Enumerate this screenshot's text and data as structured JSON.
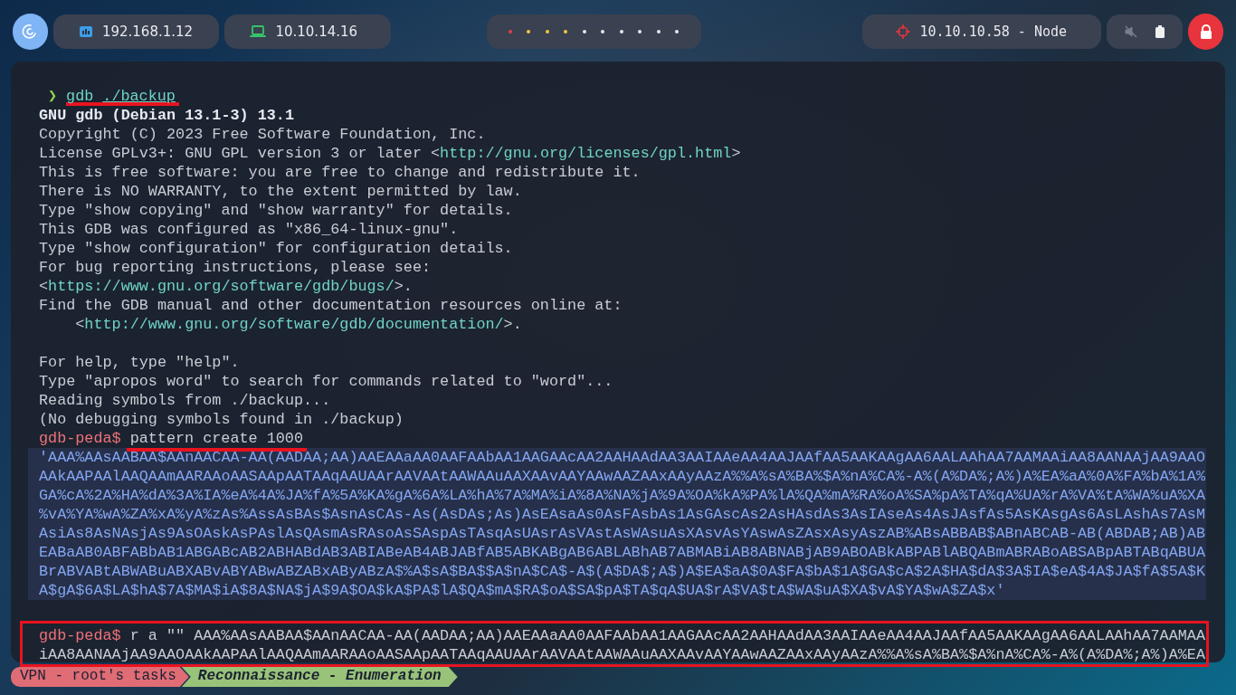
{
  "top_bar": {
    "ip_chips": [
      {
        "kind": "network",
        "text": "192.168.1.12"
      },
      {
        "kind": "laptop",
        "text": "10.10.14.16"
      }
    ],
    "workspaces": [
      {
        "color": "#e0404a"
      },
      {
        "color": "#f5c542"
      },
      {
        "color": "#f5c542"
      },
      {
        "color": "#f5c542"
      },
      {
        "color": "#e8e8e8"
      },
      {
        "color": "#e8e8e8"
      },
      {
        "color": "#e8e8e8"
      },
      {
        "color": "#e8e8e8"
      },
      {
        "color": "#e8e8e8"
      },
      {
        "color": "#e8e8e8"
      }
    ],
    "target": {
      "text": "10.10.10.58 - Node"
    }
  },
  "terminal": {
    "first_command": {
      "prompt": "❯",
      "program": "gdb",
      "argument": "./backup"
    },
    "output": [
      {
        "kind": "bold",
        "segments": [
          {
            "kind": "plain",
            "text": "GNU gdb (Debian 13.1-3) 13.1"
          }
        ]
      },
      {
        "kind": "plain",
        "segments": [
          {
            "kind": "plain",
            "text": "Copyright (C) 2023 Free Software Foundation, Inc."
          }
        ]
      },
      {
        "kind": "plain",
        "segments": [
          {
            "kind": "plain",
            "text": "License GPLv3+: GNU GPL version 3 or later <"
          },
          {
            "kind": "link",
            "text": "http://gnu.org/licenses/gpl.html"
          },
          {
            "kind": "plain",
            "text": ">"
          }
        ]
      },
      {
        "kind": "plain",
        "segments": [
          {
            "kind": "plain",
            "text": "This is free software: you are free to change and redistribute it."
          }
        ]
      },
      {
        "kind": "plain",
        "segments": [
          {
            "kind": "plain",
            "text": "There is NO WARRANTY, to the extent permitted by law."
          }
        ]
      },
      {
        "kind": "plain",
        "segments": [
          {
            "kind": "plain",
            "text": "Type \"show copying\" and \"show warranty\" for details."
          }
        ]
      },
      {
        "kind": "plain",
        "segments": [
          {
            "kind": "plain",
            "text": "This GDB was configured as \"x86_64-linux-gnu\"."
          }
        ]
      },
      {
        "kind": "plain",
        "segments": [
          {
            "kind": "plain",
            "text": "Type \"show configuration\" for configuration details."
          }
        ]
      },
      {
        "kind": "plain",
        "segments": [
          {
            "kind": "plain",
            "text": "For bug reporting instructions, please see:"
          }
        ]
      },
      {
        "kind": "plain",
        "segments": [
          {
            "kind": "plain",
            "text": "<"
          },
          {
            "kind": "link",
            "text": "https://www.gnu.org/software/gdb/bugs/"
          },
          {
            "kind": "plain",
            "text": ">."
          }
        ]
      },
      {
        "kind": "plain",
        "segments": [
          {
            "kind": "plain",
            "text": "Find the GDB manual and other documentation resources online at:"
          }
        ]
      },
      {
        "kind": "plain",
        "segments": [
          {
            "kind": "plain",
            "text": "    <"
          },
          {
            "kind": "link",
            "text": "http://www.gnu.org/software/gdb/documentation/"
          },
          {
            "kind": "plain",
            "text": ">."
          }
        ]
      },
      {
        "kind": "blank"
      },
      {
        "kind": "plain",
        "segments": [
          {
            "kind": "plain",
            "text": "For help, type \"help\"."
          }
        ]
      },
      {
        "kind": "plain",
        "segments": [
          {
            "kind": "plain",
            "text": "Type \"apropos word\" to search for commands related to \"word\"..."
          }
        ]
      },
      {
        "kind": "plain",
        "segments": [
          {
            "kind": "plain",
            "text": "Reading symbols from ./backup..."
          }
        ]
      },
      {
        "kind": "plain",
        "segments": [
          {
            "kind": "plain",
            "text": "(No debugging symbols found in ./backup)"
          }
        ]
      }
    ],
    "pattern_command": {
      "prompt": "gdb-peda$",
      "command": "pattern create 1000"
    },
    "pattern_output": [
      "'AAA%AAsAABAA$AAnAACAA-AA(AADAA;AA)AAEAAaAA0AAFAAbAA1AAGAAcAA2AAHAAdAA3AAIAAeAA4AAJAAfAA5AAKAAgAA6AALAAhAA7AAMAAiAA8AANAAjAA9AAO",
      "AAkAAPAAlAAQAAmAARAAoAASAApAATAAqAAUAArAAVAAtAAWAAuAAXAAvAAYAAwAAZAAxAAyAAzA%%A%sA%BA%$A%nA%CA%-A%(A%DA%;A%)A%EA%aA%0A%FA%bA%1A%",
      "GA%cA%2A%HA%dA%3A%IA%eA%4A%JA%fA%5A%KA%gA%6A%LA%hA%7A%MA%iA%8A%NA%jA%9A%OA%kA%PA%lA%QA%mA%RA%oA%SA%pA%TA%qA%UA%rA%VA%tA%WA%uA%XA",
      "%vA%YA%wA%ZA%xA%yA%zAs%AssAsBAs$AsnAsCAs-As(AsDAs;As)AsEAsaAs0AsFAsbAs1AsGAscAs2AsHAsdAs3AsIAseAs4AsJAsfAs5AsKAsgAs6AsLAshAs7AsM",
      "AsiAs8AsNAsjAs9AsOAskAsPAslAsQAsmAsRAsoAsSAspAsTAsqAsUAsrAsVAstAsWAsuAsXAsvAsYAswAsZAsxAsyAszAB%ABsABBAB$ABnABCAB-AB(ABDAB;AB)AB",
      "EABaAB0ABFABbAB1ABGABcAB2ABHABdAB3ABIABeAB4ABJABfAB5ABKABgAB6ABLABhAB7ABMABiAB8ABNABjAB9ABOABkABPABlABQABmABRABoABSABpABTABqABUA",
      "BrABVABtABWABuABXABvABYABwABZABxAByABzA$%A$sA$BA$$A$nA$CA$-A$(A$DA$;A$)A$EA$aA$0A$FA$bA$1A$GA$cA$2A$HA$dA$3A$IA$eA$4A$JA$fA$5A$K",
      "A$gA$6A$LA$hA$7A$MA$iA$8A$NA$jA$9A$OA$kA$PA$lA$QA$mA$RA$oA$SA$pA$TA$qA$UA$rA$VA$tA$WA$uA$XA$vA$YA$wA$ZA$x'"
    ],
    "run_command": {
      "prompt": "gdb-peda$",
      "lines": [
        "r a \"\" AAA%AAsAABAA$AAnAACAA-AA(AADAA;AA)AAEAAaAA0AAFAAbAA1AAGAAcAA2AAHAAdAA3AAIAAeAA4AAJAAfAA5AAKAAgAA6AALAAhAA7AAMAA",
        "iAA8AANAAjAA9AAOAAkAAPAAlAAQAAmAARAAoAASAApAATAAqAAUAArAAVAAtAAWAAuAAXAAvAAYAAwAAZAAxAAyAAzA%%A%sA%BA%$A%nA%CA%-A%(A%DA%;A%)A%EA"
      ]
    }
  },
  "status_bar": [
    {
      "kind": "session",
      "text": "VPN - root's tasks"
    },
    {
      "kind": "window",
      "text": "Reconnaissance - Enumeration"
    }
  ]
}
